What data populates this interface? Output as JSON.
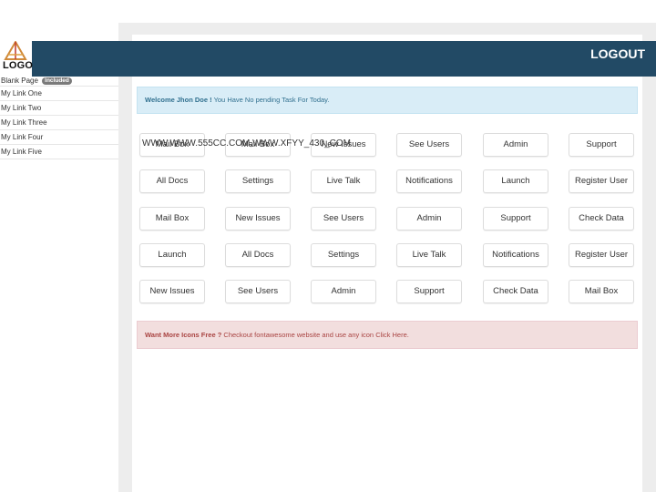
{
  "header": {
    "logout_label": "LOGOUT",
    "logo_text": "LOGO",
    "bar_color": "#224a65"
  },
  "sidebar": {
    "items": [
      {
        "label": "Blank Page",
        "badge": "Included"
      },
      {
        "label": "My Link One"
      },
      {
        "label": "My Link Two"
      },
      {
        "label": "My Link Three"
      },
      {
        "label": "My Link Four"
      },
      {
        "label": "My Link Five"
      }
    ]
  },
  "welcome": {
    "bold": "Welcome Jhon Doe !",
    "text": " You Have No pending Task For Today."
  },
  "overlay_text": "WWW.WWW.555CC.COM,WWW.XFYY_430_COM",
  "grid": {
    "rows": [
      [
        "Mail Box",
        "Mail Box",
        "New Issues",
        "See Users",
        "Admin",
        "Support"
      ],
      [
        "All Docs",
        "Settings",
        "Live Talk",
        "Notifications",
        "Launch",
        "Register User"
      ],
      [
        "Mail Box",
        "New Issues",
        "See Users",
        "Admin",
        "Support",
        "Check Data"
      ],
      [
        "Launch",
        "All Docs",
        "Settings",
        "Live Talk",
        "Notifications",
        "Register User"
      ],
      [
        "New Issues",
        "See Users",
        "Admin",
        "Support",
        "Check Data",
        "Mail Box"
      ]
    ]
  },
  "promo": {
    "bold": "Want More Icons Free ?",
    "text": " Checkout fontawesome website and use any icon ",
    "link": "Click Here."
  }
}
